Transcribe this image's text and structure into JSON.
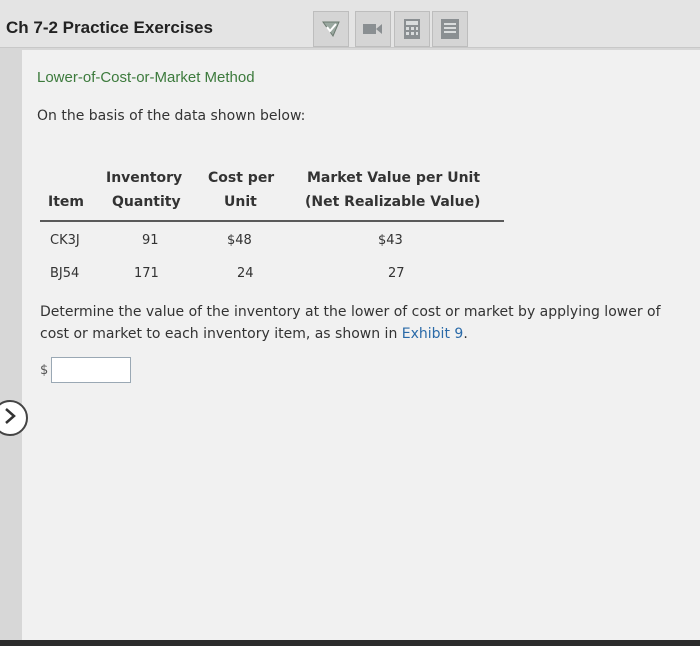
{
  "header": {
    "title": "Ch 7-2 Practice Exercises",
    "tools": [
      {
        "icon": "check-icon"
      },
      {
        "icon": "video-icon"
      },
      {
        "icon": "calculator-icon"
      },
      {
        "icon": "document-icon"
      }
    ]
  },
  "main": {
    "section_title": "Lower-of-Cost-or-Market Method",
    "intro": "On the basis of the data shown below:",
    "table": {
      "headers": {
        "item": "Item",
        "quantity_line1": "Inventory",
        "quantity_line2": "Quantity",
        "cost_line1": "Cost per",
        "cost_line2": "Unit",
        "market_line1": "Market Value per Unit",
        "market_line2": "(Net Realizable Value)"
      },
      "rows": [
        {
          "item": "CK3J",
          "quantity": "91",
          "cost": "$48",
          "market": "$43"
        },
        {
          "item": "BJ54",
          "quantity": "171",
          "cost": "24",
          "market": "27"
        }
      ]
    },
    "question": "Determine the value of the inventory at the lower of cost or market by applying lower of cost or market to each inventory item, as shown in",
    "question_link": "Exhibit 9",
    "question_end": ".",
    "answer": {
      "currency": "$",
      "value": ""
    }
  },
  "colors": {
    "section_title": "#3c7a3c",
    "link": "#2a6aa8",
    "content_bg": "#f1f1f1"
  }
}
